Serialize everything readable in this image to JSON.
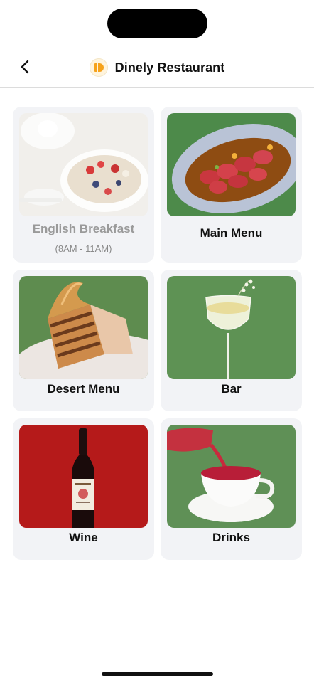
{
  "header": {
    "title": "Dinely Restaurant",
    "back_icon": "chevron-left-icon",
    "logo_icon": "dinely-logo-icon",
    "brand_color": "#f6a21a"
  },
  "menus": [
    {
      "label": "English Breakfast",
      "subtitle": "(8AM - 11AM)",
      "image": "breakfast-bowl-image",
      "enabled": false
    },
    {
      "label": "Main Menu",
      "image": "main-dish-image",
      "enabled": true
    },
    {
      "label": "Desert Menu",
      "image": "cake-slice-image",
      "enabled": true
    },
    {
      "label": "Bar",
      "image": "cocktail-glass-image",
      "enabled": true
    },
    {
      "label": "Wine",
      "image": "wine-bottle-image",
      "enabled": true
    },
    {
      "label": "Drinks",
      "image": "tea-cup-image",
      "enabled": true
    }
  ]
}
